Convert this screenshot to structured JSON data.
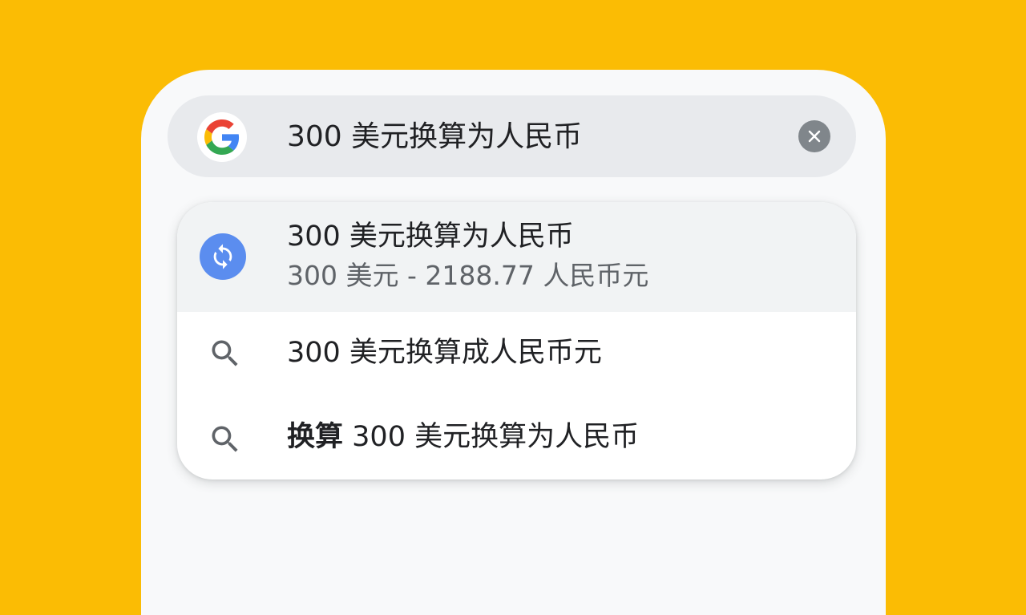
{
  "search": {
    "query": "300 美元换算为人民币",
    "clear_icon": "close-icon",
    "logo_icon": "google-g-icon"
  },
  "suggestions": {
    "conversion": {
      "icon": "currency-convert-icon",
      "title": "300 美元换算为人民币",
      "subtitle": "300 美元 - 2188.77 人民币元"
    },
    "items": [
      {
        "icon": "search-icon",
        "bold": "",
        "text": "300 美元换算成人民币元"
      },
      {
        "icon": "search-icon",
        "bold": "换算",
        "text": "300 美元换算为人民币"
      }
    ]
  },
  "colors": {
    "background": "#FBBC04",
    "accent_blue": "#5B8DEF",
    "search_bar": "#E8EAED"
  }
}
